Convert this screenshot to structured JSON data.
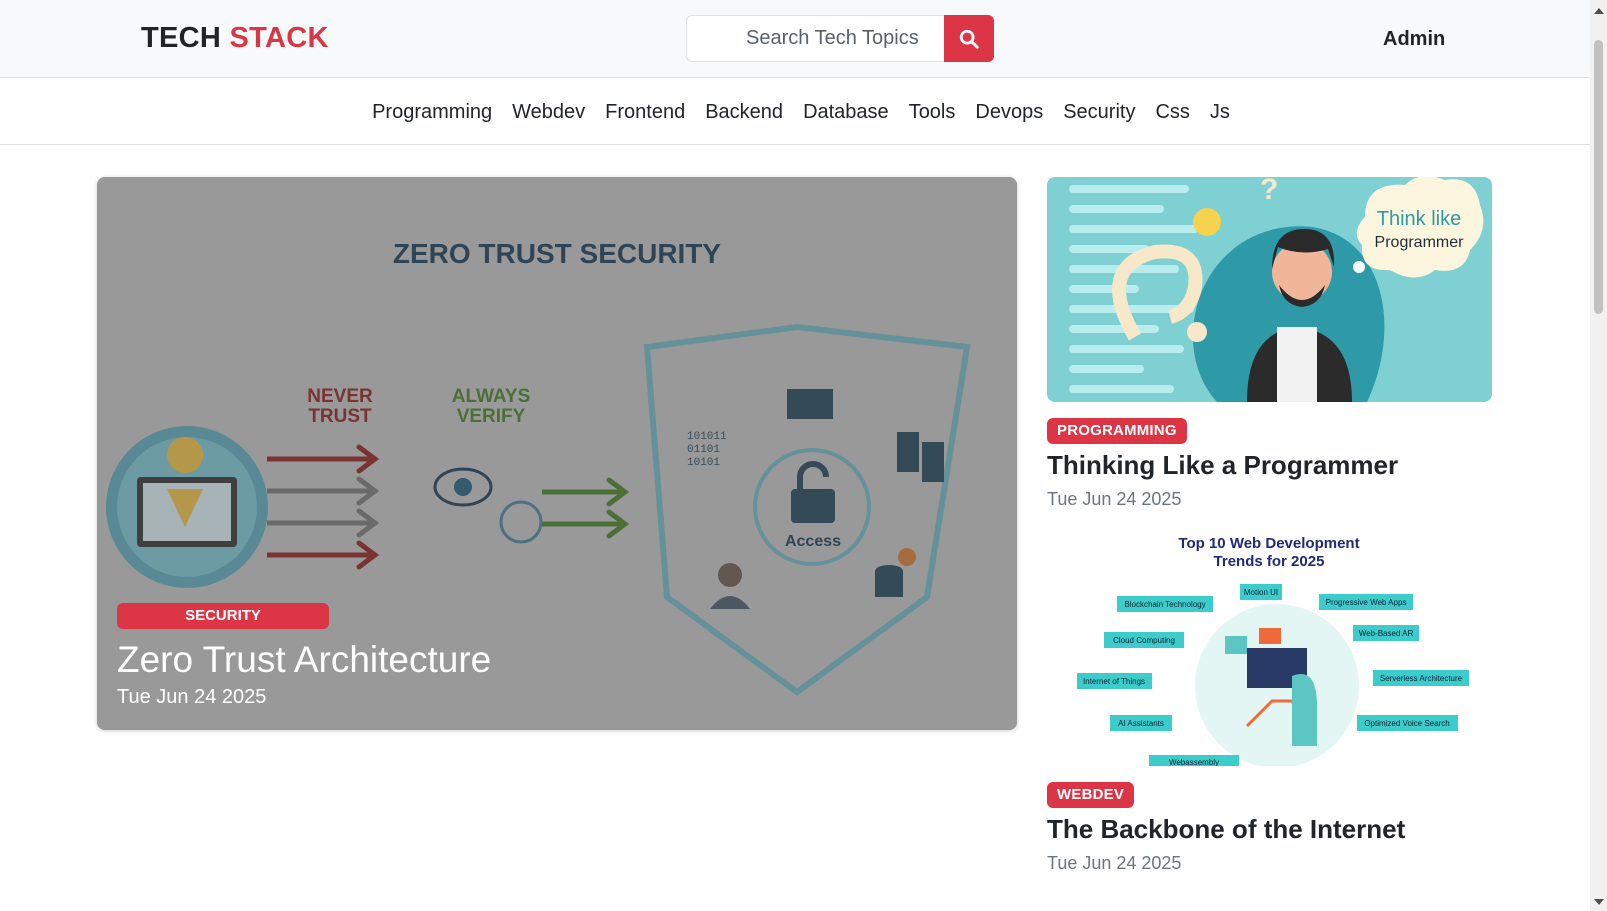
{
  "header": {
    "brand_part1": "TECH",
    "brand_part2": "STACK",
    "search_placeholder": "Search Tech Topics",
    "search_button_icon": "search-icon",
    "admin_label": "Admin"
  },
  "categories": [
    "Programming",
    "Webdev",
    "Frontend",
    "Backend",
    "Database",
    "Tools",
    "Devops",
    "Security",
    "Css",
    "Js"
  ],
  "featured": {
    "badge": "SECURITY",
    "title": "Zero Trust Architecture",
    "date": "Tue Jun 24 2025",
    "image": {
      "heading": "ZERO TRUST SECURITY",
      "never_trust": [
        "NEVER",
        "TRUST"
      ],
      "always_verify": [
        "ALWAYS",
        "VERIFY"
      ],
      "access": "Access",
      "binary": [
        "101011",
        "01101",
        "10101"
      ]
    }
  },
  "side_posts": [
    {
      "badge": "PROGRAMMING",
      "title": "Thinking Like a Programmer",
      "date": "Tue Jun 24 2025",
      "image": {
        "bubble_line1": "Think like",
        "bubble_line2": "Programmer"
      }
    },
    {
      "badge": "WEBDEV",
      "title": "The Backbone of the Internet",
      "date": "Tue Jun 24 2025",
      "image": {
        "heading_line1": "Top 10 Web Development",
        "heading_line2": "Trends for 2025",
        "tags": [
          "Blockchain Technology",
          "Motion UI",
          "Progressive Web Apps",
          "Cloud Computing",
          "Web-Based AR",
          "Internet of Things",
          "Serverless Architecture",
          "AI Assistants",
          "Optimized Voice Search",
          "Webassembly"
        ]
      }
    }
  ],
  "colors": {
    "accent": "#dc3545",
    "text": "#212529",
    "muted": "#6c757d",
    "header_bg": "#f8f9fa"
  }
}
